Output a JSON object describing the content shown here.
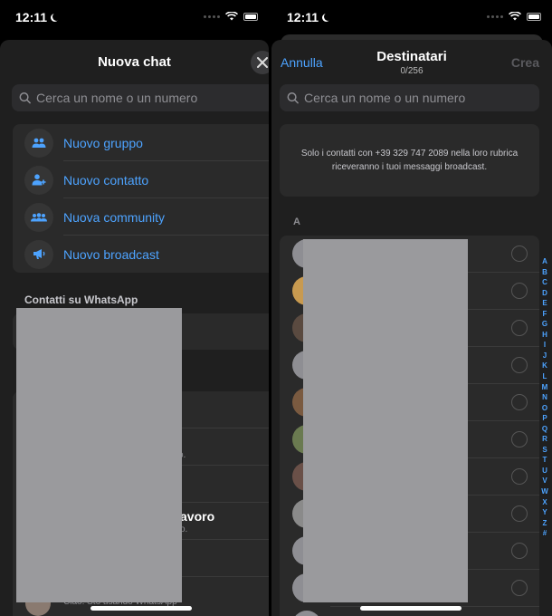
{
  "status_bar": {
    "time": "12:11"
  },
  "left": {
    "title": "Nuova chat",
    "search_placeholder": "Cerca un nome o un numero",
    "menu": [
      {
        "label": "Nuovo gruppo",
        "icon": "group-icon"
      },
      {
        "label": "Nuovo contatto",
        "icon": "add-contact-icon"
      },
      {
        "label": "Nuova community",
        "icon": "community-icon"
      },
      {
        "label": "Nuovo broadcast",
        "icon": "broadcast-icon"
      }
    ],
    "section_label": "Contatti su WhatsApp",
    "partial_name": "avoro",
    "partial_status_1": "o.",
    "partial_status_2": "o.",
    "partial_status_3": "Ciao! Sto usando WhatsApp"
  },
  "right": {
    "cancel_label": "Annulla",
    "title": "Destinatari",
    "counter": "0/256",
    "create_label": "Crea",
    "search_placeholder": "Cerca un nome o un numero",
    "info_text": "Solo i contatti con +39 329 747 2089 nella loro rubrica riceveranno i tuoi messaggi broadcast.",
    "section_letter": "A",
    "alphabet": [
      "A",
      "B",
      "C",
      "D",
      "E",
      "F",
      "G",
      "H",
      "I",
      "J",
      "K",
      "L",
      "M",
      "N",
      "O",
      "P",
      "Q",
      "R",
      "S",
      "T",
      "U",
      "V",
      "W",
      "X",
      "Y",
      "Z",
      "#"
    ]
  },
  "colors": {
    "accent": "#4da3ff",
    "background": "#1f1f1f",
    "card": "#2a2a2a"
  }
}
